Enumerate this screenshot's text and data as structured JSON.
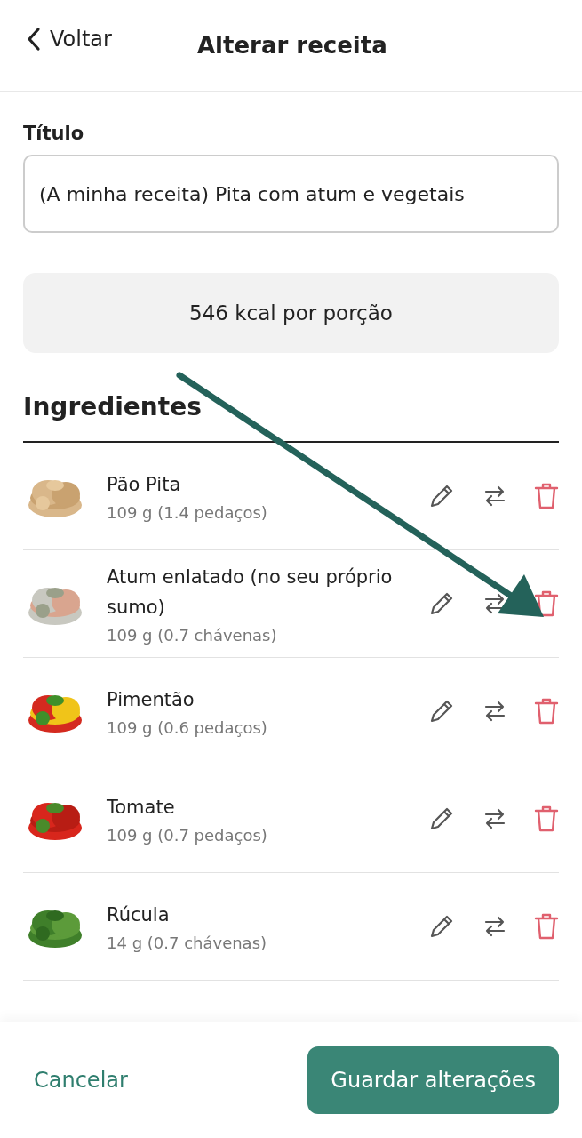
{
  "header": {
    "back": "Voltar",
    "title": "Alterar receita"
  },
  "title_field": {
    "label": "Título",
    "value": "(A minha receita) Pita com atum e vegetais"
  },
  "calories": "546 kcal por porção",
  "ingredients": {
    "heading": "Ingredientes",
    "items": [
      {
        "name": "Pão Pita",
        "amount": "109 g (1.4 pedaços)"
      },
      {
        "name": "Atum enlatado (no seu próprio sumo)",
        "amount": "109 g (0.7 chávenas)"
      },
      {
        "name": "Pimentão",
        "amount": "109 g (0.6 pedaços)"
      },
      {
        "name": "Tomate",
        "amount": "109 g (0.7 pedaços)"
      },
      {
        "name": "Rúcula",
        "amount": "14 g (0.7 chávenas)"
      }
    ]
  },
  "footer": {
    "cancel": "Cancelar",
    "save": "Guardar alterações"
  }
}
